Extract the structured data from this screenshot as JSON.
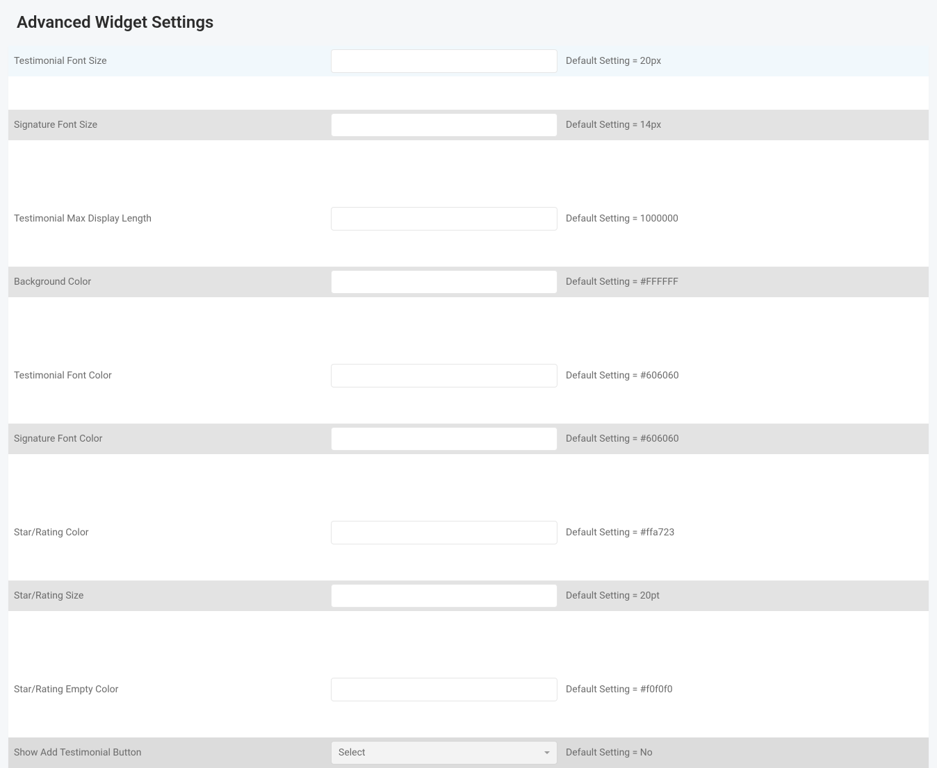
{
  "header": {
    "title": "Advanced Widget Settings"
  },
  "rows": [
    {
      "label": "Testimonial Font Size",
      "default": "Default Setting = 20px",
      "type": "text",
      "variant": "highlighted"
    },
    {
      "label": "Signature Font Size",
      "default": "Default Setting = 14px",
      "type": "text",
      "variant": "striped"
    },
    {
      "label": "Testimonial Max Display Length",
      "default": "Default Setting = 1000000",
      "type": "text",
      "variant": "plain"
    },
    {
      "label": "Background Color",
      "default": "Default Setting = #FFFFFF",
      "type": "text",
      "variant": "striped"
    },
    {
      "label": "Testimonial Font Color",
      "default": "Default Setting = #606060",
      "type": "text",
      "variant": "plain"
    },
    {
      "label": "Signature Font Color",
      "default": "Default Setting = #606060",
      "type": "text",
      "variant": "striped"
    },
    {
      "label": "Star/Rating Color",
      "default": "Default Setting = #ffa723",
      "type": "text",
      "variant": "plain"
    },
    {
      "label": "Star/Rating Size",
      "default": "Default Setting = 20pt",
      "type": "text",
      "variant": "striped"
    },
    {
      "label": "Star/Rating Empty Color",
      "default": "Default Setting = #f0f0f0",
      "type": "text",
      "variant": "plain"
    },
    {
      "label": "Show Add Testimonial Button",
      "default": "Default Setting = No",
      "type": "select",
      "select_placeholder": "Select",
      "variant": "striped-dark"
    }
  ]
}
